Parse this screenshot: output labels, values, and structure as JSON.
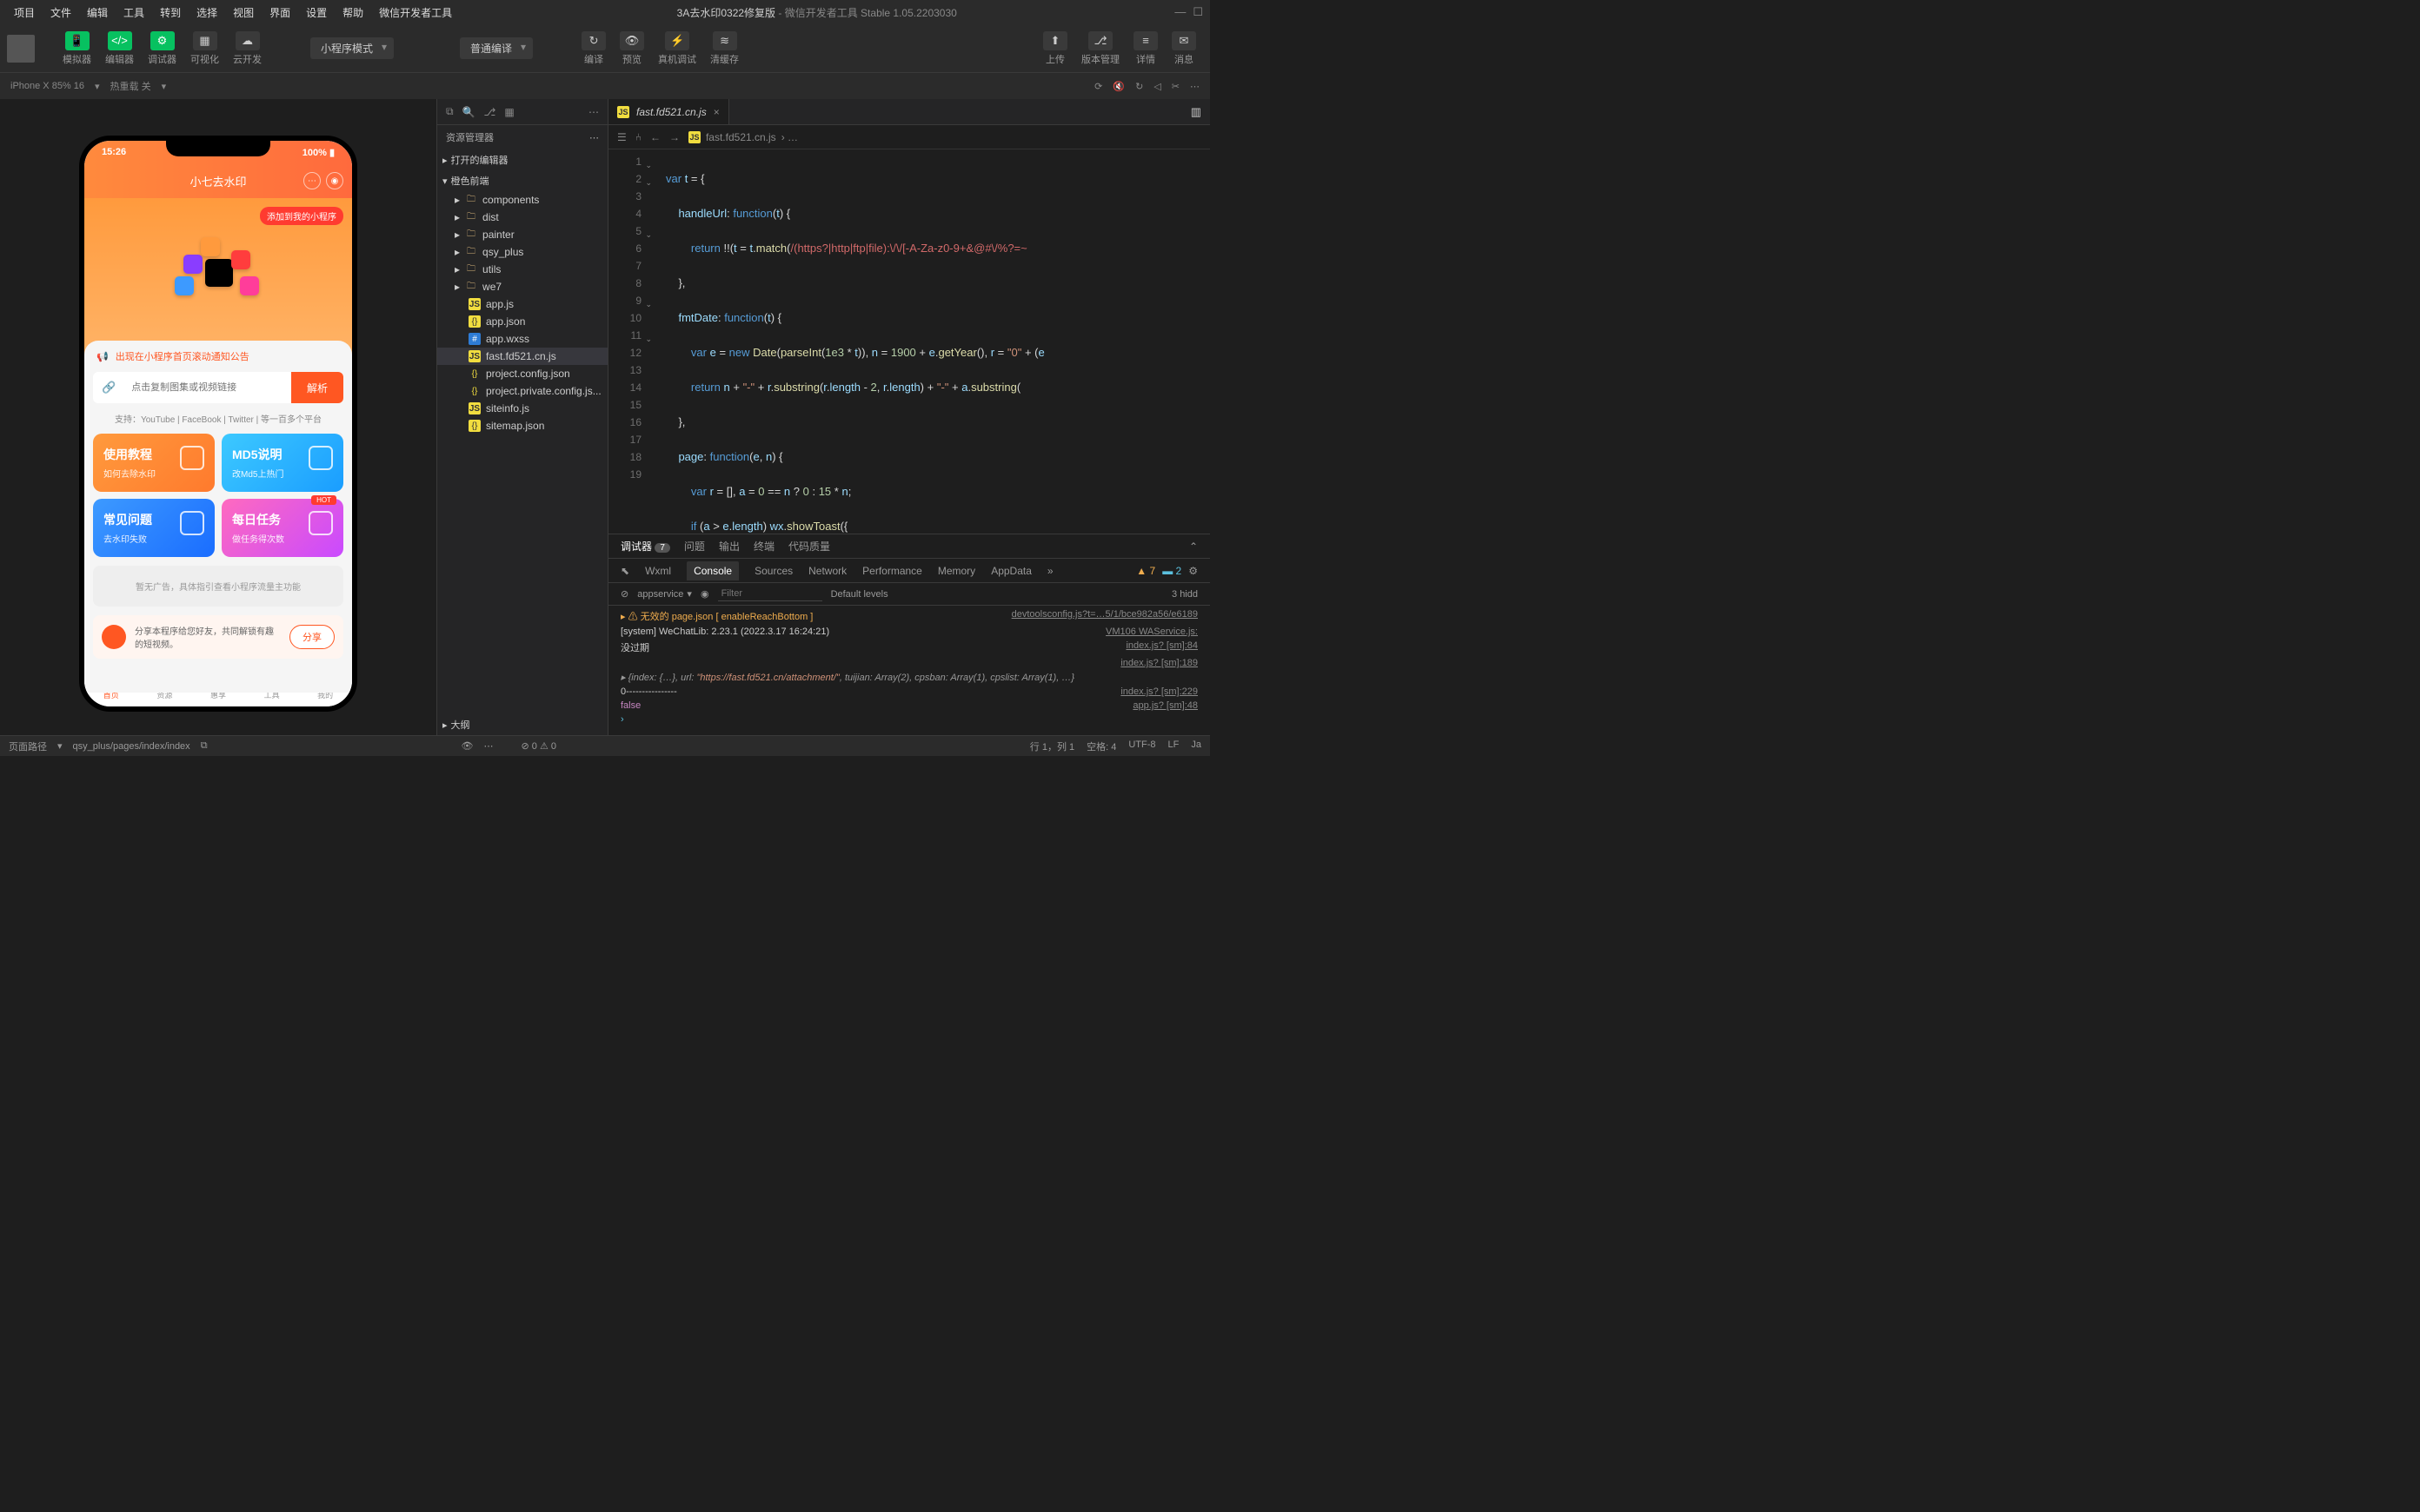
{
  "menu": [
    "项目",
    "文件",
    "编辑",
    "工具",
    "转到",
    "选择",
    "视图",
    "界面",
    "设置",
    "帮助",
    "微信开发者工具"
  ],
  "title": {
    "project": "3A去水印0322修复版",
    "app": "微信开发者工具 Stable 1.05.2203030"
  },
  "toolbar": {
    "simulator": "模拟器",
    "editor": "编辑器",
    "debugger": "调试器",
    "visualizer": "可视化",
    "cloud": "云开发",
    "mode": "小程序模式",
    "compileMode": "普通编译",
    "compile": "编译",
    "preview": "预览",
    "realDevice": "真机调试",
    "clearCache": "清缓存",
    "upload": "上传",
    "version": "版本管理",
    "detail": "详情",
    "message": "消息"
  },
  "subbar": {
    "device": "iPhone X 85% 16",
    "hotReload": "热重载 关"
  },
  "phone": {
    "time": "15:26",
    "battery": "100%",
    "appTitle": "小七去水印",
    "addBadge": "添加到我的小程序",
    "notice": "出现在小程序首页滚动通知公告",
    "inputPlaceholder": "点击复制图集或视频链接",
    "parseBtn": "解析",
    "platforms": "支持：YouTube | FaceBook | Twitter | 等一百多个平台",
    "cards": [
      {
        "title": "使用教程",
        "sub": "如何去除水印"
      },
      {
        "title": "MD5说明",
        "sub": "改Md5上热门"
      },
      {
        "title": "常见问题",
        "sub": "去水印失败"
      },
      {
        "title": "每日任务",
        "sub": "做任务得次数",
        "hot": "HOT"
      }
    ],
    "adText": "暂无广告，具体指引查看小程序流量主功能",
    "shareText": "分享本程序给您好友，共同解锁有趣的短视频。",
    "shareBtn": "分享",
    "tabs": [
      "首页",
      "资源",
      "惠享",
      "工具",
      "我的"
    ]
  },
  "explorer": {
    "header": "资源管理器",
    "openEditors": "打开的编辑器",
    "root": "橙色前端",
    "folders": [
      "components",
      "dist",
      "painter",
      "qsy_plus",
      "utils",
      "we7"
    ],
    "files": [
      {
        "name": "app.js",
        "type": "js"
      },
      {
        "name": "app.json",
        "type": "json"
      },
      {
        "name": "app.wxss",
        "type": "wxss"
      },
      {
        "name": "fast.fd521.cn.js",
        "type": "js",
        "selected": true
      },
      {
        "name": "project.config.json",
        "type": "config"
      },
      {
        "name": "project.private.config.js...",
        "type": "config"
      },
      {
        "name": "siteinfo.js",
        "type": "js"
      },
      {
        "name": "sitemap.json",
        "type": "json"
      }
    ],
    "outline": "大纲"
  },
  "editor": {
    "tabName": "fast.fd521.cn.js",
    "breadcrumb": "fast.fd521.cn.js",
    "lines": 19
  },
  "bottomTabs": {
    "debugger": "调试器",
    "debuggerCount": "7",
    "problems": "问题",
    "output": "输出",
    "terminal": "终端",
    "codeQuality": "代码质量"
  },
  "devtools": {
    "tabs": [
      "Wxml",
      "Console",
      "Sources",
      "Network",
      "Performance",
      "Memory",
      "AppData"
    ],
    "warnCount": "7",
    "infoCount": "2",
    "context": "appservice",
    "filterPlaceholder": "Filter",
    "levels": "Default levels",
    "hidden": "3 hidd"
  },
  "console": [
    {
      "type": "warn",
      "msg": "无效的 page.json [ enableReachBottom ]",
      "src": "devtoolsconfig.js?t=…5/1/bce982a56/e6189"
    },
    {
      "msg": "[system] WeChatLib: 2.23.1 (2022.3.17 16:24:21)",
      "src": "VM106 WAService.js:"
    },
    {
      "msg": "没过期",
      "src": "index.js? [sm]:84"
    },
    {
      "msg": "",
      "src": "index.js? [sm]:189"
    },
    {
      "type": "obj",
      "msg": "{index: {…}, url: \"https://fast.fd521.cn/attachment/\", tuijian: Array(2), cpsban: Array(1), cpslist: Array(1), …}",
      "src": ""
    },
    {
      "msg": "0----------------",
      "src": "index.js? [sm]:229"
    },
    {
      "msg": "false",
      "src": "app.js? [sm]:48"
    }
  ],
  "status": {
    "pagePath": "页面路径",
    "path": "qsy_plus/pages/index/index",
    "errors": "0",
    "warnings": "0",
    "cursor": "行 1，列 1",
    "spaces": "空格: 4",
    "encoding": "UTF-8",
    "eol": "LF",
    "lang": "Ja"
  }
}
